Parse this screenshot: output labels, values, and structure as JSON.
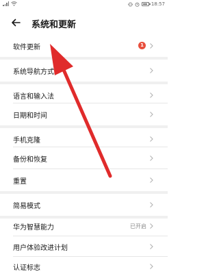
{
  "status_bar": {
    "time": "18:57"
  },
  "header": {
    "title": "系统和更新",
    "back_icon": "back-arrow-icon"
  },
  "colors": {
    "badge": "#e84f3d",
    "arrow_annotation": "#e02b2b",
    "section_gap": "#f0f0f0"
  },
  "items": [
    {
      "label": "软件更新",
      "badge": "1",
      "chevron": "chevron-right-icon"
    },
    {
      "label": "系统导航方式",
      "chevron": "chevron-right-icon"
    },
    {
      "label": "语言和输入法",
      "chevron": "chevron-right-icon"
    },
    {
      "label": "日期和时间",
      "chevron": "chevron-right-icon"
    },
    {
      "label": "手机克隆",
      "chevron": "chevron-right-icon"
    },
    {
      "label": "备份和恢复",
      "chevron": "chevron-right-icon"
    },
    {
      "label": "重置",
      "chevron": "chevron-right-icon"
    },
    {
      "label": "简易模式",
      "chevron": "chevron-right-icon"
    },
    {
      "label": "华为智慧能力",
      "value": "已开启",
      "chevron": "chevron-right-icon"
    },
    {
      "label": "用户体验改进计划",
      "chevron": "chevron-right-icon"
    },
    {
      "label": "认证标志",
      "chevron": "chevron-right-icon"
    }
  ]
}
